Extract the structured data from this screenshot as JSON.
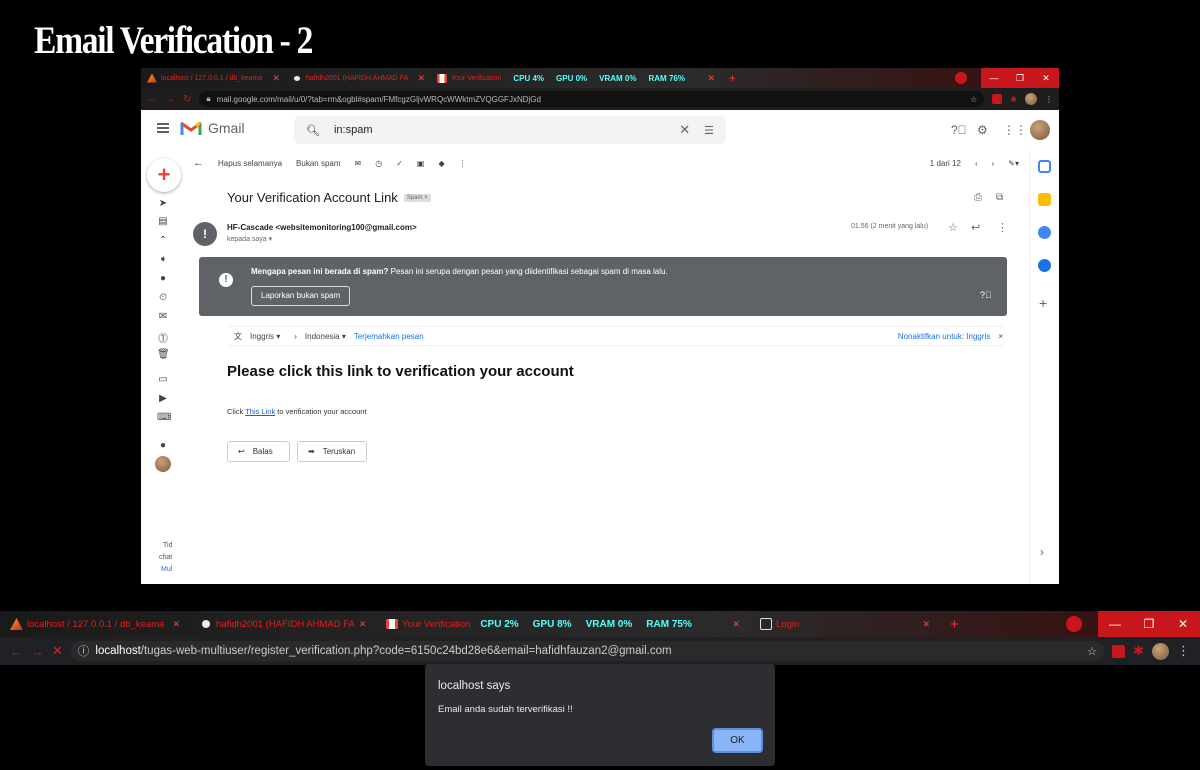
{
  "title": "Email Verification - 2",
  "window1": {
    "tabs": [
      {
        "label": "localhost / 127.0.0.1 / db_keama",
        "icon": "xampp-icon"
      },
      {
        "label": "hafidh2001 (HAFIDH AHMAD FA",
        "icon": "github-icon"
      },
      {
        "label": "Your Verification",
        "icon": "gmail-icon"
      }
    ],
    "hud": {
      "cpu": "CPU  4%",
      "gpu": "GPU  0%",
      "vram": "VRAM  0%",
      "ram": "RAM  76%"
    },
    "url": "mail.google.com/mail/u/0/?tab=rm&ogbl#spam/FMfcgzGljvWRQcWWktmZVQGGFJxNDjGd",
    "gmail": {
      "app_name": "Gmail",
      "search_value": "in:spam",
      "toolbar": {
        "delete_forever": "Hapus selamanya",
        "not_spam": "Bukan spam",
        "pager": "1 dari 12"
      },
      "subject": "Your Verification Account Link",
      "spam_tag": "Spam ×",
      "sender": "HF-Cascade <websitemonitoring100@gmail.com>",
      "to": "kepada saya ▾",
      "time": "01.56 (2 menit yang lalu)",
      "warning": {
        "bold": "Mengapa pesan ini berada di spam?",
        "text": " Pesan ini serupa dengan pesan yang diidentifikasi sebagai spam di masa lalu.",
        "button": "Laporkan bukan spam"
      },
      "translate": {
        "from": "Inggris ▾",
        "to": "Indonesia ▾",
        "link": "Terjemahkan pesan",
        "disable": "Nonaktifkan untuk: Inggris"
      },
      "body_heading": "Please click this link to verification your account",
      "body_prefix": "Click ",
      "body_link": "This Link",
      "body_suffix": " to verification your account",
      "reply": "Balas",
      "forward": "Teruskan",
      "chat_text": [
        "Tid",
        "chat",
        "Mul"
      ]
    }
  },
  "window2": {
    "tabs": [
      {
        "label": "localhost / 127.0.0.1 / db_keama",
        "icon": "xampp-icon"
      },
      {
        "label": "hafidh2001 (HAFIDH AHMAD FA",
        "icon": "github-icon"
      },
      {
        "label": "Your Verification",
        "icon": "gmail-icon"
      },
      {
        "label": "Login",
        "icon": "site-icon"
      }
    ],
    "hud": {
      "cpu": "CPU  2%",
      "gpu": "GPU  8%",
      "vram": "VRAM  0%",
      "ram": "RAM  75%"
    },
    "url_host": "localhost",
    "url_path": "/tugas-web-multiuser/register_verification.php?code=6150c24bd28e6&email=hafidhfauzan2@gmail.com",
    "dialog": {
      "title": "localhost says",
      "message": "Email anda sudah terverifikasi !!",
      "ok": "OK"
    }
  }
}
